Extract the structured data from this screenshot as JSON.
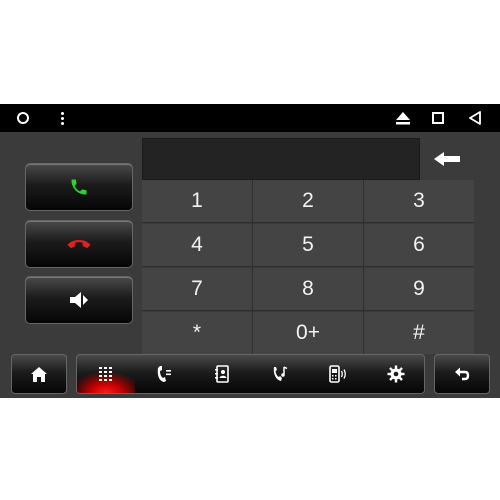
{
  "status_bar": {
    "icons": [
      "circle-icon",
      "overflow-menu-icon",
      "eject-icon",
      "recent-apps-icon",
      "nav-back-icon"
    ]
  },
  "dialer": {
    "number_display": "",
    "keys": [
      "1",
      "2",
      "3",
      "4",
      "5",
      "6",
      "7",
      "8",
      "9",
      "*",
      "0+",
      "#"
    ]
  },
  "side_buttons": [
    "call-icon",
    "hang-up-icon",
    "volume-icon"
  ],
  "bottom_bar": {
    "tabs": [
      "dialpad-icon",
      "call-log-icon",
      "contacts-icon",
      "music-icon",
      "phone-device-icon",
      "settings-icon"
    ],
    "active_tab": "dialpad-icon"
  },
  "colors": {
    "call_green": "#2bd32b",
    "hangup_red": "#e02020",
    "active_tab_red": "#e00000",
    "screen_bg": "#3b3b3b",
    "status_bar_bg": "#000000"
  }
}
